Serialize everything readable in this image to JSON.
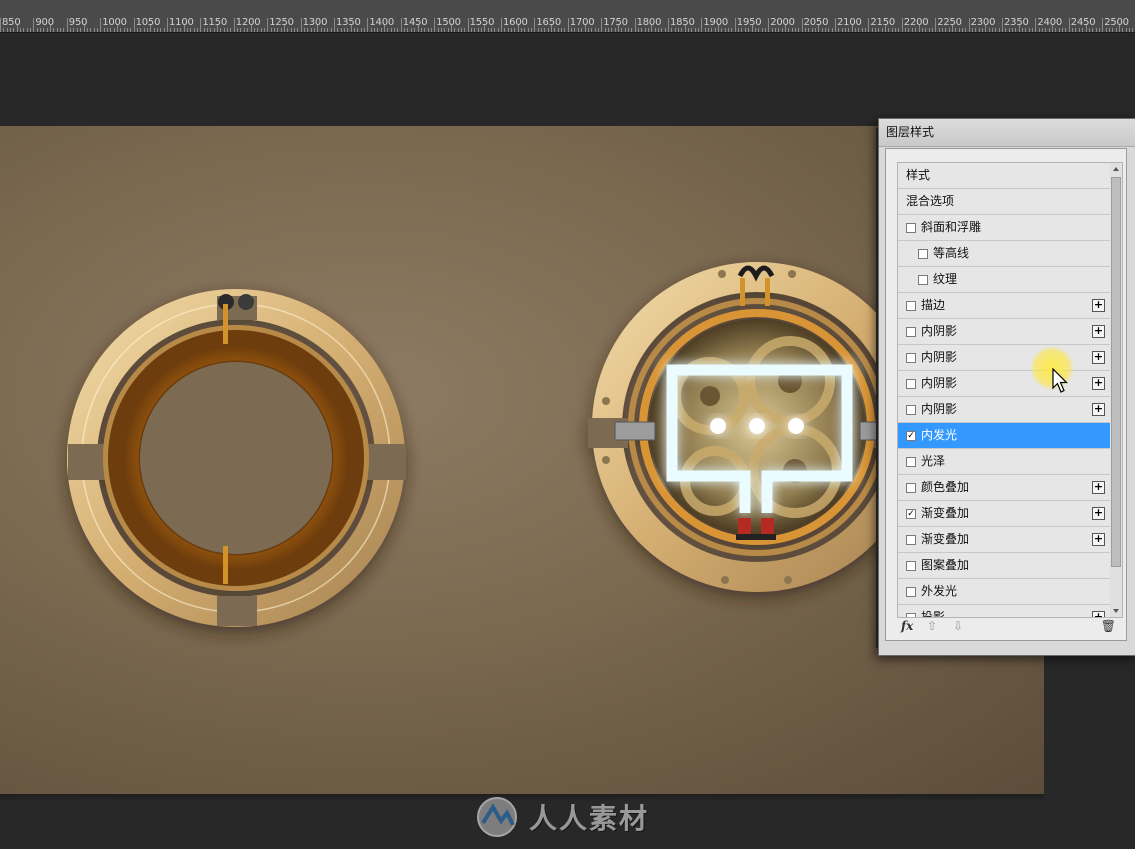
{
  "ruler": {
    "labels": [
      "850",
      "900",
      "950",
      "1000",
      "1050",
      "1100",
      "1150",
      "1200",
      "1250",
      "1300",
      "1350",
      "1400",
      "1450",
      "1500",
      "1550",
      "1600",
      "1650",
      "1700",
      "1750",
      "1800",
      "1850",
      "1900",
      "1950",
      "2000",
      "2050",
      "2100",
      "2150",
      "2200",
      "2250",
      "2300",
      "2350",
      "2400",
      "2450",
      "2500"
    ]
  },
  "dialog": {
    "title": "图层样式",
    "header_styles": "样式",
    "header_blend": "混合选项",
    "items": [
      {
        "label": "斜面和浮雕",
        "checked": false,
        "indent": false,
        "plus": false
      },
      {
        "label": "等高线",
        "checked": false,
        "indent": true,
        "plus": false
      },
      {
        "label": "纹理",
        "checked": false,
        "indent": true,
        "plus": false
      },
      {
        "label": "描边",
        "checked": false,
        "indent": false,
        "plus": true
      },
      {
        "label": "内阴影",
        "checked": false,
        "indent": false,
        "plus": true
      },
      {
        "label": "内阴影",
        "checked": false,
        "indent": false,
        "plus": true
      },
      {
        "label": "内阴影",
        "checked": false,
        "indent": false,
        "plus": true
      },
      {
        "label": "内阴影",
        "checked": false,
        "indent": false,
        "plus": true
      },
      {
        "label": "内发光",
        "checked": true,
        "indent": false,
        "plus": false,
        "selected": true
      },
      {
        "label": "光泽",
        "checked": false,
        "indent": false,
        "plus": false
      },
      {
        "label": "颜色叠加",
        "checked": false,
        "indent": false,
        "plus": true
      },
      {
        "label": "渐变叠加",
        "checked": true,
        "indent": false,
        "plus": true
      },
      {
        "label": "渐变叠加",
        "checked": false,
        "indent": false,
        "plus": true
      },
      {
        "label": "图案叠加",
        "checked": false,
        "indent": false,
        "plus": false
      },
      {
        "label": "外发光",
        "checked": false,
        "indent": false,
        "plus": false
      },
      {
        "label": "投影",
        "checked": false,
        "indent": false,
        "plus": true
      }
    ],
    "footer_fx": "fx",
    "icons": [
      "fx-icon",
      "move-up-icon",
      "move-down-icon",
      "trash-icon"
    ]
  },
  "watermark": {
    "text": "人人素材"
  },
  "colors": {
    "selected_row": "#3399ff",
    "brass": "#d7b47a",
    "glow": "#e9fbff",
    "canvas": "#7d6b52"
  }
}
